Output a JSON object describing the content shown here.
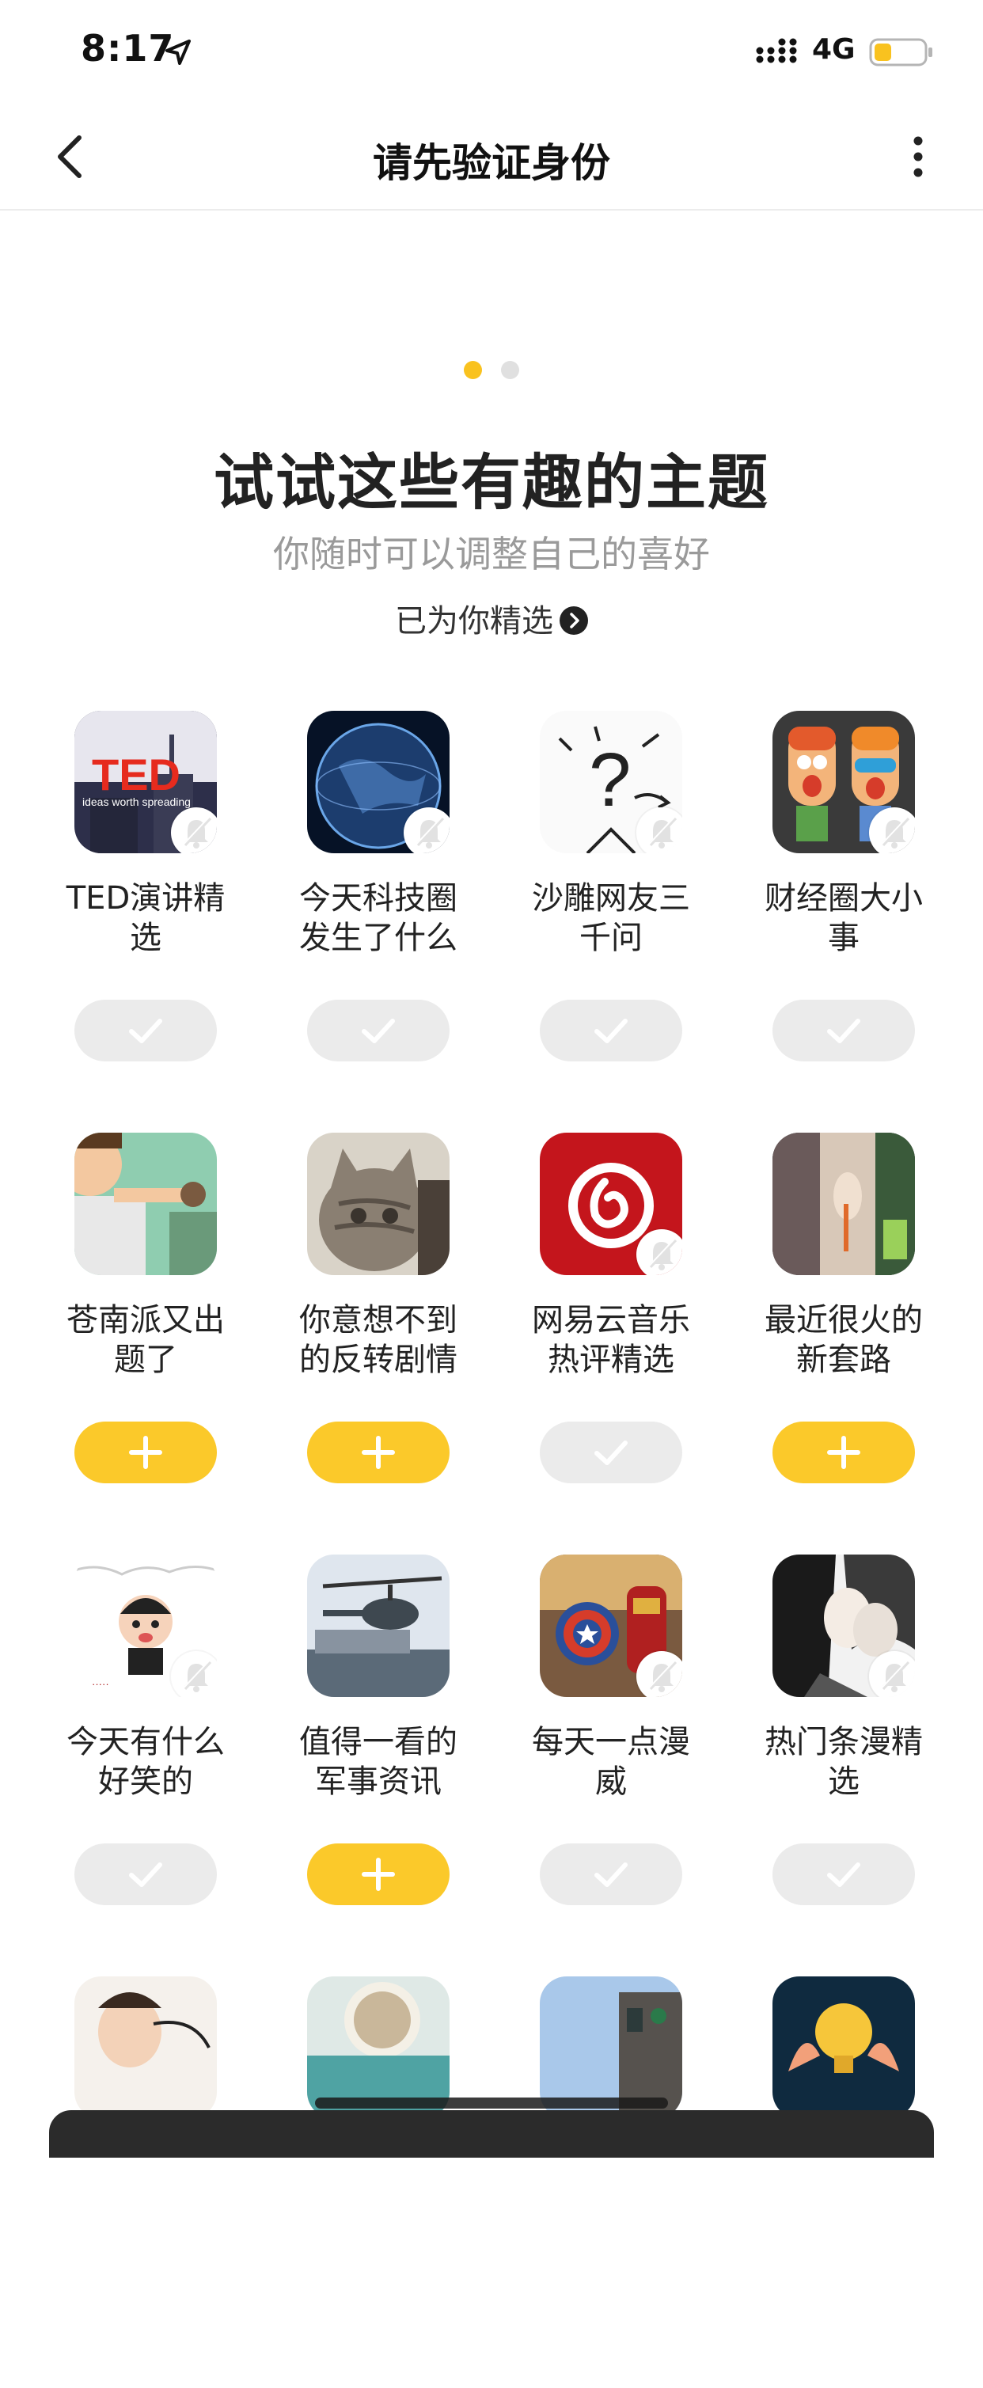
{
  "status_bar": {
    "time": "8:17",
    "network": "4G",
    "battery_level": 0.35,
    "battery_color": "#f9c21f"
  },
  "nav": {
    "title": "请先验证身份",
    "back_icon": "chevron-left-icon",
    "more_icon": "more-vertical-icon"
  },
  "pager": {
    "total": 2,
    "active_index": 0
  },
  "header": {
    "title": "试试这些有趣的主题",
    "subtitle": "你随时可以调整自己的喜好",
    "selected_link": "已为你精选"
  },
  "colors": {
    "accent": "#fbc92a",
    "subscribed_button": "#ebebeb",
    "pager_active": "#f9c21f"
  },
  "topics": [
    {
      "name": "TED演讲精\n选",
      "thumb_text": "TED",
      "thumb_caption": "ideas worth spreading",
      "status": "subscribed"
    },
    {
      "name": "今天科技圈\n发生了什么",
      "status": "subscribed"
    },
    {
      "name": "沙雕网友三\n千问",
      "thumb_text": "?",
      "status": "subscribed"
    },
    {
      "name": "财经圈大小\n事",
      "status": "subscribed"
    },
    {
      "name": "苍南派又出\n题了",
      "status": "add"
    },
    {
      "name": "你意想不到\n的反转剧情",
      "status": "add"
    },
    {
      "name": "网易云音乐\n热评精选",
      "status": "subscribed"
    },
    {
      "name": "最近很火的\n新套路",
      "status": "add"
    },
    {
      "name": "今天有什么\n好笑的",
      "status": "subscribed"
    },
    {
      "name": "值得一看的\n军事资讯",
      "status": "add"
    },
    {
      "name": "每天一点漫\n威",
      "status": "subscribed"
    },
    {
      "name": "热门条漫精\n选",
      "status": "subscribed"
    },
    {
      "name": "",
      "status": "hidden"
    },
    {
      "name": "",
      "status": "hidden"
    },
    {
      "name": "",
      "status": "hidden"
    },
    {
      "name": "",
      "status": "hidden"
    }
  ]
}
